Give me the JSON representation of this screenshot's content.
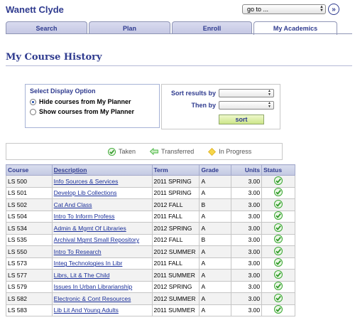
{
  "header": {
    "username": "Wanett Clyde",
    "goto_value": "go to ...",
    "goto_button_glyph": "»"
  },
  "tabs": [
    {
      "label": "Search",
      "active": false
    },
    {
      "label": "Plan",
      "active": false
    },
    {
      "label": "Enroll",
      "active": false
    },
    {
      "label": "My Academics",
      "active": true
    }
  ],
  "page_title": "My Course History",
  "display_option": {
    "heading": "Select Display Option",
    "options": [
      {
        "label": "Hide courses from My Planner",
        "selected": true
      },
      {
        "label": "Show courses from My Planner",
        "selected": false
      }
    ]
  },
  "sort": {
    "sort_by_label": "Sort results by",
    "then_by_label": "Then by",
    "sort_by_value": "",
    "then_by_value": "",
    "button_label": "sort"
  },
  "legend": [
    {
      "label": "Taken",
      "icon": "check-icon",
      "color": "#3aa832"
    },
    {
      "label": "Transferred",
      "icon": "arrow-left-icon",
      "color": "#4cb847"
    },
    {
      "label": "In Progress",
      "icon": "diamond-icon",
      "color": "#f3c623"
    }
  ],
  "table": {
    "headers": [
      "Course",
      "Description",
      "Term",
      "Grade",
      "Units",
      "Status"
    ],
    "rows": [
      {
        "course": "LS 500",
        "description": "Info Sources & Services",
        "term": "2011 SPRING",
        "grade": "A",
        "units": "3.00",
        "status": "taken"
      },
      {
        "course": "LS 501",
        "description": "Develop Lib Collections",
        "term": "2011 SPRING",
        "grade": "A",
        "units": "3.00",
        "status": "taken"
      },
      {
        "course": "LS 502",
        "description": "Cat And Class",
        "term": "2012 FALL",
        "grade": "B",
        "units": "3.00",
        "status": "taken"
      },
      {
        "course": "LS 504",
        "description": "Intro To Inform Profess",
        "term": "2011 FALL",
        "grade": "A",
        "units": "3.00",
        "status": "taken"
      },
      {
        "course": "LS 534",
        "description": "Admin & Mgmt Of Libraries",
        "term": "2012 SPRING",
        "grade": "A",
        "units": "3.00",
        "status": "taken"
      },
      {
        "course": "LS 535",
        "description": "Archival Mgmt Small Repository",
        "term": "2012 FALL",
        "grade": "B",
        "units": "3.00",
        "status": "taken"
      },
      {
        "course": "LS 550",
        "description": "Intro To Research",
        "term": "2012 SUMMER",
        "grade": "A",
        "units": "3.00",
        "status": "taken"
      },
      {
        "course": "LS 573",
        "description": "Integ Technologies In Libr",
        "term": "2011 FALL",
        "grade": "A",
        "units": "3.00",
        "status": "taken"
      },
      {
        "course": "LS 577",
        "description": "Librs, Lit & The Child",
        "term": "2011 SUMMER",
        "grade": "A",
        "units": "3.00",
        "status": "taken"
      },
      {
        "course": "LS 579",
        "description": "Issues In Urban Librarianship",
        "term": "2012 SPRING",
        "grade": "A",
        "units": "3.00",
        "status": "taken"
      },
      {
        "course": "LS 582",
        "description": "Electronic & Cont Resources",
        "term": "2012 SUMMER",
        "grade": "A",
        "units": "3.00",
        "status": "taken"
      },
      {
        "course": "LS 583",
        "description": "Lib Lit And Young Adults",
        "term": "2011 SUMMER",
        "grade": "A",
        "units": "3.00",
        "status": "taken"
      }
    ]
  },
  "colors": {
    "brand": "#2f3b8f",
    "link": "#1a2f9a",
    "check": "#3aa832"
  }
}
